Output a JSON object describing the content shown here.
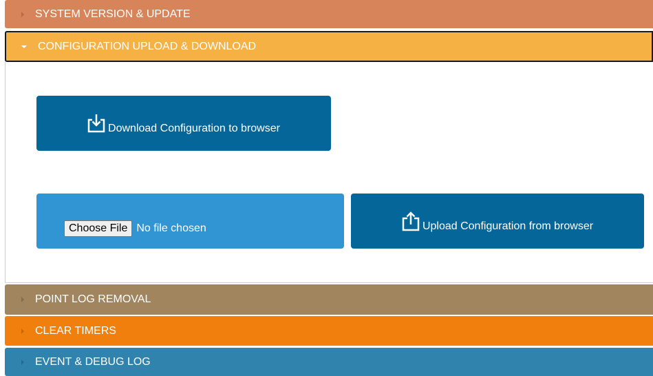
{
  "accordion": {
    "system_version": {
      "label": "SYSTEM VERSION & UPDATE",
      "expanded": false,
      "color": "#d8845a"
    },
    "configuration": {
      "label": "CONFIGURATION UPLOAD & DOWNLOAD",
      "expanded": true,
      "color": "#f5b144"
    },
    "point_log": {
      "label": "POINT LOG REMOVAL",
      "expanded": false,
      "color": "#a0855e"
    },
    "clear_timers": {
      "label": "CLEAR TIMERS",
      "expanded": false,
      "color": "#f07f0e"
    },
    "event_debug": {
      "label": "EVENT & DEBUG LOG",
      "expanded": false,
      "color": "#2f83ad"
    }
  },
  "config_panel": {
    "download_button": {
      "label": "Download Configuration to browser",
      "icon": "download-icon",
      "color": "#05669a"
    },
    "file_input": {
      "button_label": "Choose File",
      "status": "No file chosen",
      "background": "#3195d3"
    },
    "upload_button": {
      "label": "Upload Configuration from browser",
      "icon": "upload-icon",
      "color": "#05669a"
    }
  }
}
